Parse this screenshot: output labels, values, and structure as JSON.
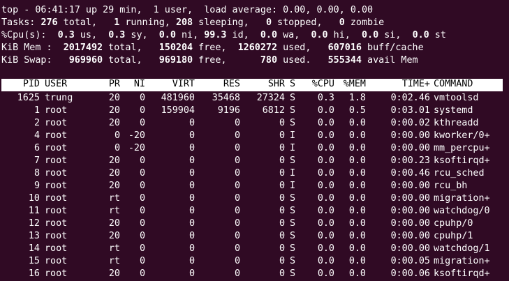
{
  "summary": {
    "line1": {
      "prefix": "top - ",
      "time": "06:41:17",
      "up": " up 29 min,  1 user,  load average: 0.00, 0.00, 0.00"
    },
    "tasks": {
      "label": "Tasks: ",
      "total": "276",
      "total_l": " total,   ",
      "running": "1",
      "running_l": " running, ",
      "sleeping": "208",
      "sleeping_l": " sleeping,   ",
      "stopped": "0",
      "stopped_l": " stopped,   ",
      "zombie": "0",
      "zombie_l": " zombie"
    },
    "cpu": {
      "label": "%Cpu(s):  ",
      "us": "0.3",
      "us_l": " us,  ",
      "sy": "0.3",
      "sy_l": " sy,  ",
      "ni": "0.0",
      "ni_l": " ni, ",
      "id": "99.3",
      "id_l": " id,  ",
      "wa": "0.0",
      "wa_l": " wa,  ",
      "hi": "0.0",
      "hi_l": " hi,  ",
      "si": "0.0",
      "si_l": " si,  ",
      "st": "0.0",
      "st_l": " st"
    },
    "mem": {
      "label": "KiB Mem :  ",
      "total": "2017492",
      "total_l": " total,   ",
      "free": "150204",
      "free_l": " free,  ",
      "used": "1260272",
      "used_l": " used,   ",
      "cache": "607016",
      "cache_l": " buff/cache"
    },
    "swap": {
      "label": "KiB Swap:   ",
      "total": "969960",
      "total_l": " total,   ",
      "free": "969180",
      "free_l": " free,      ",
      "used": "780",
      "used_l": " used.   ",
      "avail": "555344",
      "avail_l": " avail Mem"
    }
  },
  "columns": {
    "pid": "PID",
    "user": "USER",
    "pr": "PR",
    "ni": "NI",
    "virt": "VIRT",
    "res": "RES",
    "shr": "SHR",
    "s": "S",
    "cpu": "%CPU",
    "mem": "%MEM",
    "time": "TIME+",
    "command": "COMMAND"
  },
  "processes": [
    {
      "pid": "1625",
      "user": "trung",
      "pr": "20",
      "ni": "0",
      "virt": "481960",
      "res": "35468",
      "shr": "27324",
      "s": "S",
      "cpu": "0.3",
      "mem": "1.8",
      "time": "0:02.46",
      "command": "vmtoolsd"
    },
    {
      "pid": "1",
      "user": "root",
      "pr": "20",
      "ni": "0",
      "virt": "159904",
      "res": "9196",
      "shr": "6812",
      "s": "S",
      "cpu": "0.0",
      "mem": "0.5",
      "time": "0:03.01",
      "command": "systemd"
    },
    {
      "pid": "2",
      "user": "root",
      "pr": "20",
      "ni": "0",
      "virt": "0",
      "res": "0",
      "shr": "0",
      "s": "S",
      "cpu": "0.0",
      "mem": "0.0",
      "time": "0:00.02",
      "command": "kthreadd"
    },
    {
      "pid": "4",
      "user": "root",
      "pr": "0",
      "ni": "-20",
      "virt": "0",
      "res": "0",
      "shr": "0",
      "s": "I",
      "cpu": "0.0",
      "mem": "0.0",
      "time": "0:00.00",
      "command": "kworker/0+"
    },
    {
      "pid": "6",
      "user": "root",
      "pr": "0",
      "ni": "-20",
      "virt": "0",
      "res": "0",
      "shr": "0",
      "s": "I",
      "cpu": "0.0",
      "mem": "0.0",
      "time": "0:00.00",
      "command": "mm_percpu+"
    },
    {
      "pid": "7",
      "user": "root",
      "pr": "20",
      "ni": "0",
      "virt": "0",
      "res": "0",
      "shr": "0",
      "s": "S",
      "cpu": "0.0",
      "mem": "0.0",
      "time": "0:00.23",
      "command": "ksoftirqd+"
    },
    {
      "pid": "8",
      "user": "root",
      "pr": "20",
      "ni": "0",
      "virt": "0",
      "res": "0",
      "shr": "0",
      "s": "I",
      "cpu": "0.0",
      "mem": "0.0",
      "time": "0:00.46",
      "command": "rcu_sched"
    },
    {
      "pid": "9",
      "user": "root",
      "pr": "20",
      "ni": "0",
      "virt": "0",
      "res": "0",
      "shr": "0",
      "s": "I",
      "cpu": "0.0",
      "mem": "0.0",
      "time": "0:00.00",
      "command": "rcu_bh"
    },
    {
      "pid": "10",
      "user": "root",
      "pr": "rt",
      "ni": "0",
      "virt": "0",
      "res": "0",
      "shr": "0",
      "s": "S",
      "cpu": "0.0",
      "mem": "0.0",
      "time": "0:00.00",
      "command": "migration+"
    },
    {
      "pid": "11",
      "user": "root",
      "pr": "rt",
      "ni": "0",
      "virt": "0",
      "res": "0",
      "shr": "0",
      "s": "S",
      "cpu": "0.0",
      "mem": "0.0",
      "time": "0:00.00",
      "command": "watchdog/0"
    },
    {
      "pid": "12",
      "user": "root",
      "pr": "20",
      "ni": "0",
      "virt": "0",
      "res": "0",
      "shr": "0",
      "s": "S",
      "cpu": "0.0",
      "mem": "0.0",
      "time": "0:00.00",
      "command": "cpuhp/0"
    },
    {
      "pid": "13",
      "user": "root",
      "pr": "20",
      "ni": "0",
      "virt": "0",
      "res": "0",
      "shr": "0",
      "s": "S",
      "cpu": "0.0",
      "mem": "0.0",
      "time": "0:00.00",
      "command": "cpuhp/1"
    },
    {
      "pid": "14",
      "user": "root",
      "pr": "rt",
      "ni": "0",
      "virt": "0",
      "res": "0",
      "shr": "0",
      "s": "S",
      "cpu": "0.0",
      "mem": "0.0",
      "time": "0:00.00",
      "command": "watchdog/1"
    },
    {
      "pid": "15",
      "user": "root",
      "pr": "rt",
      "ni": "0",
      "virt": "0",
      "res": "0",
      "shr": "0",
      "s": "S",
      "cpu": "0.0",
      "mem": "0.0",
      "time": "0:00.05",
      "command": "migration+"
    },
    {
      "pid": "16",
      "user": "root",
      "pr": "20",
      "ni": "0",
      "virt": "0",
      "res": "0",
      "shr": "0",
      "s": "S",
      "cpu": "0.0",
      "mem": "0.0",
      "time": "0:00.06",
      "command": "ksoftirqd+"
    }
  ],
  "colors": {
    "background": "#300a24",
    "foreground": "#ffffff",
    "header_bar_bg": "#ffffff",
    "header_bar_fg": "#000000"
  }
}
